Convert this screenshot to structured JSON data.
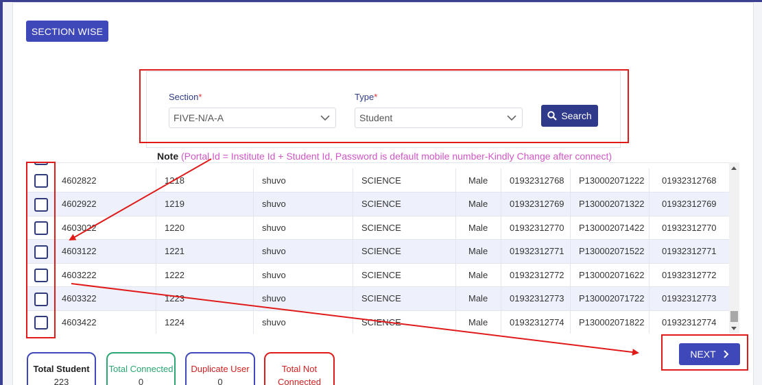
{
  "header": {
    "section_wise_label": "SECTION WISE"
  },
  "filters": {
    "section_label": "Section",
    "section_value": "FIVE-N/A-A",
    "type_label": "Type",
    "type_value": "Student",
    "required_mark": "*",
    "search_label": "Search"
  },
  "note": {
    "label": "Note",
    "text": "(Portal Id = Institute Id + Student Id, Password is default mobile number-Kindly Change after connect)"
  },
  "table": {
    "rows": [
      [
        "4602822",
        "1218",
        "shuvo",
        "SCIENCE",
        "Male",
        "01932312768",
        "P130002071222",
        "01932312768"
      ],
      [
        "4602922",
        "1219",
        "shuvo",
        "SCIENCE",
        "Male",
        "01932312769",
        "P130002071322",
        "01932312769"
      ],
      [
        "4603022",
        "1220",
        "shuvo",
        "SCIENCE",
        "Male",
        "01932312770",
        "P130002071422",
        "01932312770"
      ],
      [
        "4603122",
        "1221",
        "shuvo",
        "SCIENCE",
        "Male",
        "01932312771",
        "P130002071522",
        "01932312771"
      ],
      [
        "4603222",
        "1222",
        "shuvo",
        "SCIENCE",
        "Male",
        "01932312772",
        "P130002071622",
        "01932312772"
      ],
      [
        "4603322",
        "1223",
        "shuvo",
        "SCIENCE",
        "Male",
        "01932312773",
        "P130002071722",
        "01932312773"
      ],
      [
        "4603422",
        "1224",
        "shuvo",
        "SCIENCE",
        "Male",
        "01932312774",
        "P130002071822",
        "01932312774"
      ]
    ]
  },
  "actions": {
    "next_label": "NEXT"
  },
  "stats": {
    "total_student": {
      "label": "Total Student",
      "value": "223"
    },
    "total_connected": {
      "label": "Total Connected",
      "value": "0"
    },
    "duplicate_user": {
      "label": "Duplicate User",
      "value": "0"
    },
    "total_not_connected": {
      "label": "Total Not Connected"
    }
  },
  "colors": {
    "primary": "#3f48b8",
    "dark_primary": "#2f3a8a",
    "annotation_red": "#e01919",
    "note_pink": "#d155c7",
    "connected_green": "#2ba673",
    "duplicate_red": "#d11f1f"
  }
}
